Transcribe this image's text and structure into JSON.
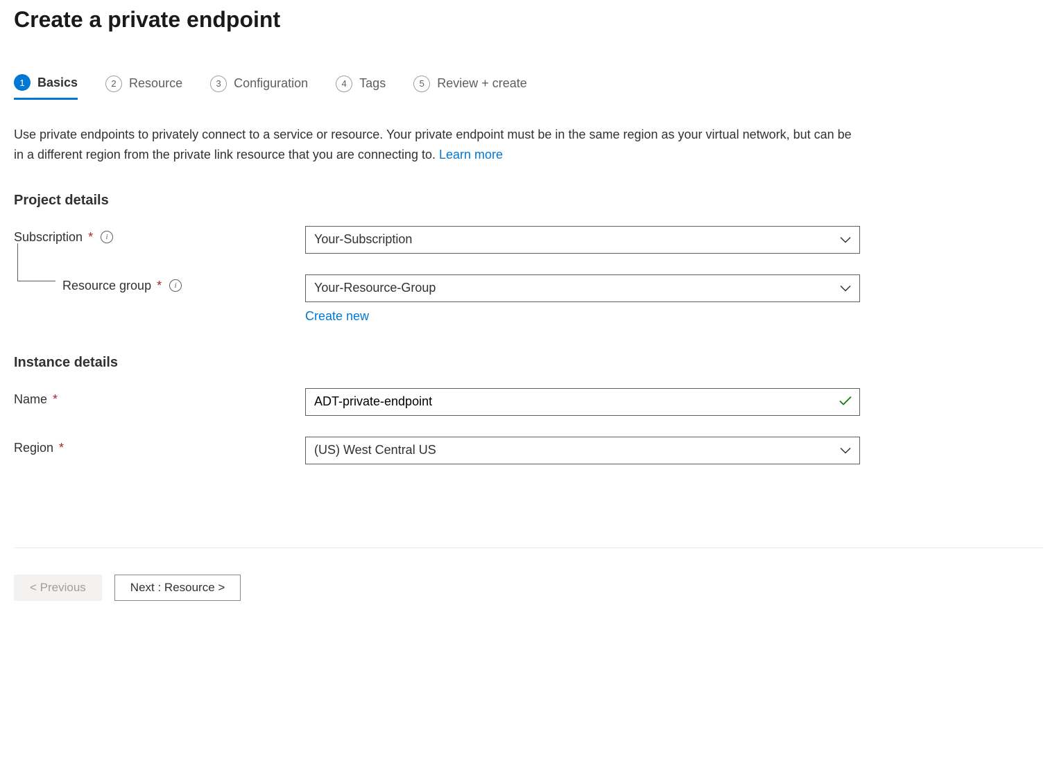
{
  "page_title": "Create a private endpoint",
  "tabs": [
    {
      "num": "1",
      "label": "Basics"
    },
    {
      "num": "2",
      "label": "Resource"
    },
    {
      "num": "3",
      "label": "Configuration"
    },
    {
      "num": "4",
      "label": "Tags"
    },
    {
      "num": "5",
      "label": "Review + create"
    }
  ],
  "description_text": "Use private endpoints to privately connect to a service or resource. Your private endpoint must be in the same region as your virtual network, but can be in a different region from the private link resource that you are connecting to.  ",
  "learn_more": "Learn more",
  "sections": {
    "project": {
      "header": "Project details",
      "subscription_label": "Subscription",
      "subscription_value": "Your-Subscription",
      "resource_group_label": "Resource group",
      "resource_group_value": "Your-Resource-Group",
      "create_new": "Create new"
    },
    "instance": {
      "header": "Instance details",
      "name_label": "Name",
      "name_value": "ADT-private-endpoint",
      "region_label": "Region",
      "region_value": "(US) West Central US"
    }
  },
  "footer": {
    "previous": "< Previous",
    "next": "Next : Resource >"
  }
}
